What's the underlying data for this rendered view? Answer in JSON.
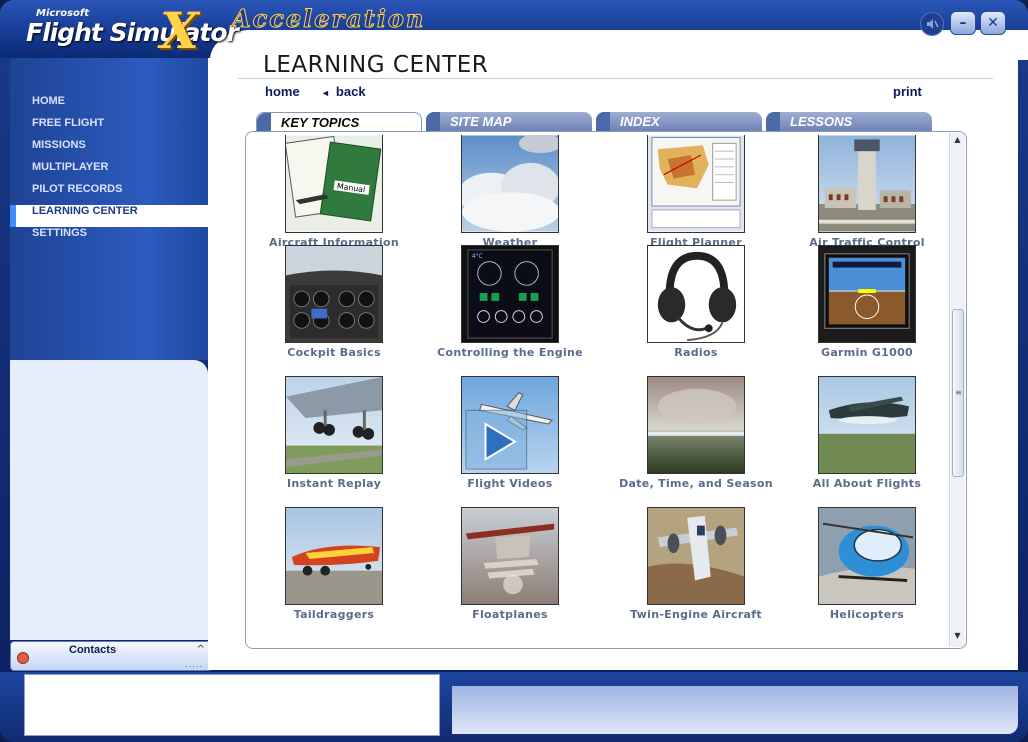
{
  "titlebar": {
    "brand_small": "Microsoft",
    "brand_main": "Flight Simulator",
    "brand_x": "X",
    "brand_edition": "Acceleration",
    "minimize_label": "–",
    "close_label": "✕",
    "speaker_icon": "speaker-muted-icon"
  },
  "sidebar": {
    "items": [
      {
        "label": "HOME"
      },
      {
        "label": "FREE FLIGHT"
      },
      {
        "label": "MISSIONS"
      },
      {
        "label": "MULTIPLAYER"
      },
      {
        "label": "PILOT RECORDS"
      },
      {
        "label": "LEARNING CENTER"
      },
      {
        "label": "SETTINGS"
      }
    ],
    "active_index": 5
  },
  "contacts": {
    "label": "Contacts",
    "chevron": "^",
    "grip": "....."
  },
  "main": {
    "title": "LEARNING CENTER",
    "nav": {
      "home": "home",
      "back": "back",
      "back_arrow": "◄",
      "print": "print"
    },
    "tabs": [
      {
        "label": "KEY TOPICS",
        "active": true
      },
      {
        "label": "SITE MAP",
        "active": false
      },
      {
        "label": "INDEX",
        "active": false
      },
      {
        "label": "LESSONS",
        "active": false
      }
    ],
    "scroll": {
      "up": "▲",
      "down": "▼",
      "grip": "≡"
    },
    "topics": [
      {
        "label": "Aircraft Information",
        "icon": "manual-thumbnail"
      },
      {
        "label": "Weather",
        "icon": "clouds-thumbnail"
      },
      {
        "label": "Flight Planner",
        "icon": "map-thumbnail"
      },
      {
        "label": "Air Traffic Control",
        "icon": "tower-thumbnail"
      },
      {
        "label": "Cockpit Basics",
        "icon": "cockpit-thumbnail"
      },
      {
        "label": "Controlling the Engine",
        "icon": "engine-gauges-thumbnail"
      },
      {
        "label": "Radios",
        "icon": "headset-thumbnail"
      },
      {
        "label": "Garmin G1000",
        "icon": "glass-cockpit-thumbnail"
      },
      {
        "label": "Instant Replay",
        "icon": "landing-gear-thumbnail"
      },
      {
        "label": "Flight Videos",
        "icon": "video-play-thumbnail"
      },
      {
        "label": "Date, Time, and Season",
        "icon": "sky-landscape-thumbnail"
      },
      {
        "label": "All About Flights",
        "icon": "seaplane-thumbnail"
      },
      {
        "label": "Taildraggers",
        "icon": "taildragger-thumbnail"
      },
      {
        "label": "Floatplanes",
        "icon": "floatplane-thumbnail"
      },
      {
        "label": "Twin-Engine Aircraft",
        "icon": "twin-engine-thumbnail"
      },
      {
        "label": "Helicopters",
        "icon": "helicopter-thumbnail"
      }
    ]
  }
}
